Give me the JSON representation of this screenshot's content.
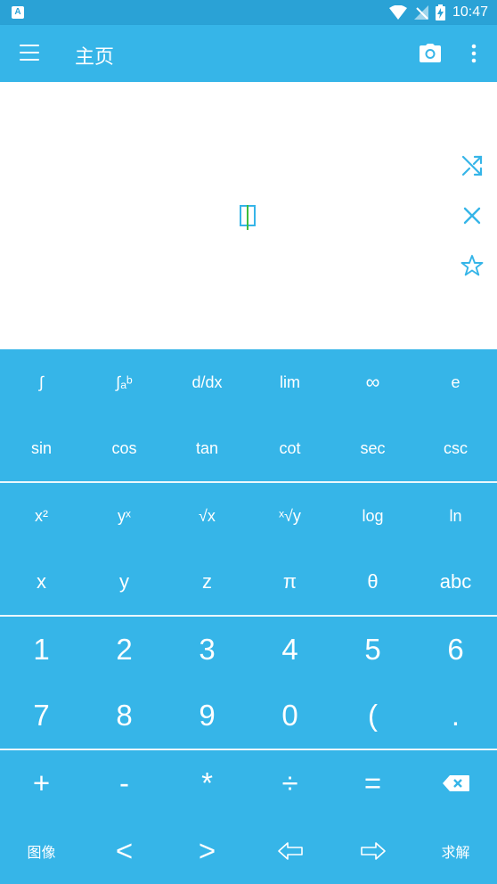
{
  "status_bar": {
    "left_badge": "A",
    "time": "10:47"
  },
  "app_bar": {
    "title": "主页"
  },
  "keypad": {
    "row1": [
      "∫",
      "∫ₐᵇ",
      "d/dx",
      "lim",
      "∞",
      "e"
    ],
    "row2": [
      "sin",
      "cos",
      "tan",
      "cot",
      "sec",
      "csc"
    ],
    "row3": [
      "x²",
      "yˣ",
      "√x",
      "ˣ√y",
      "log",
      "ln"
    ],
    "row4": [
      "x",
      "y",
      "z",
      "π",
      "θ",
      "abc"
    ],
    "row5": [
      "1",
      "2",
      "3",
      "4",
      "5",
      "6"
    ],
    "row6": [
      "7",
      "8",
      "9",
      "0",
      "(",
      "."
    ],
    "row7": [
      "+",
      "-",
      "*",
      "÷",
      "=",
      ""
    ],
    "row8": [
      "图像",
      "<",
      ">",
      "",
      "",
      "求解"
    ]
  },
  "colors": {
    "primary": "#36b5e8",
    "status_bar": "#2aa2d6",
    "cursor_caret": "#3dbd3d"
  }
}
